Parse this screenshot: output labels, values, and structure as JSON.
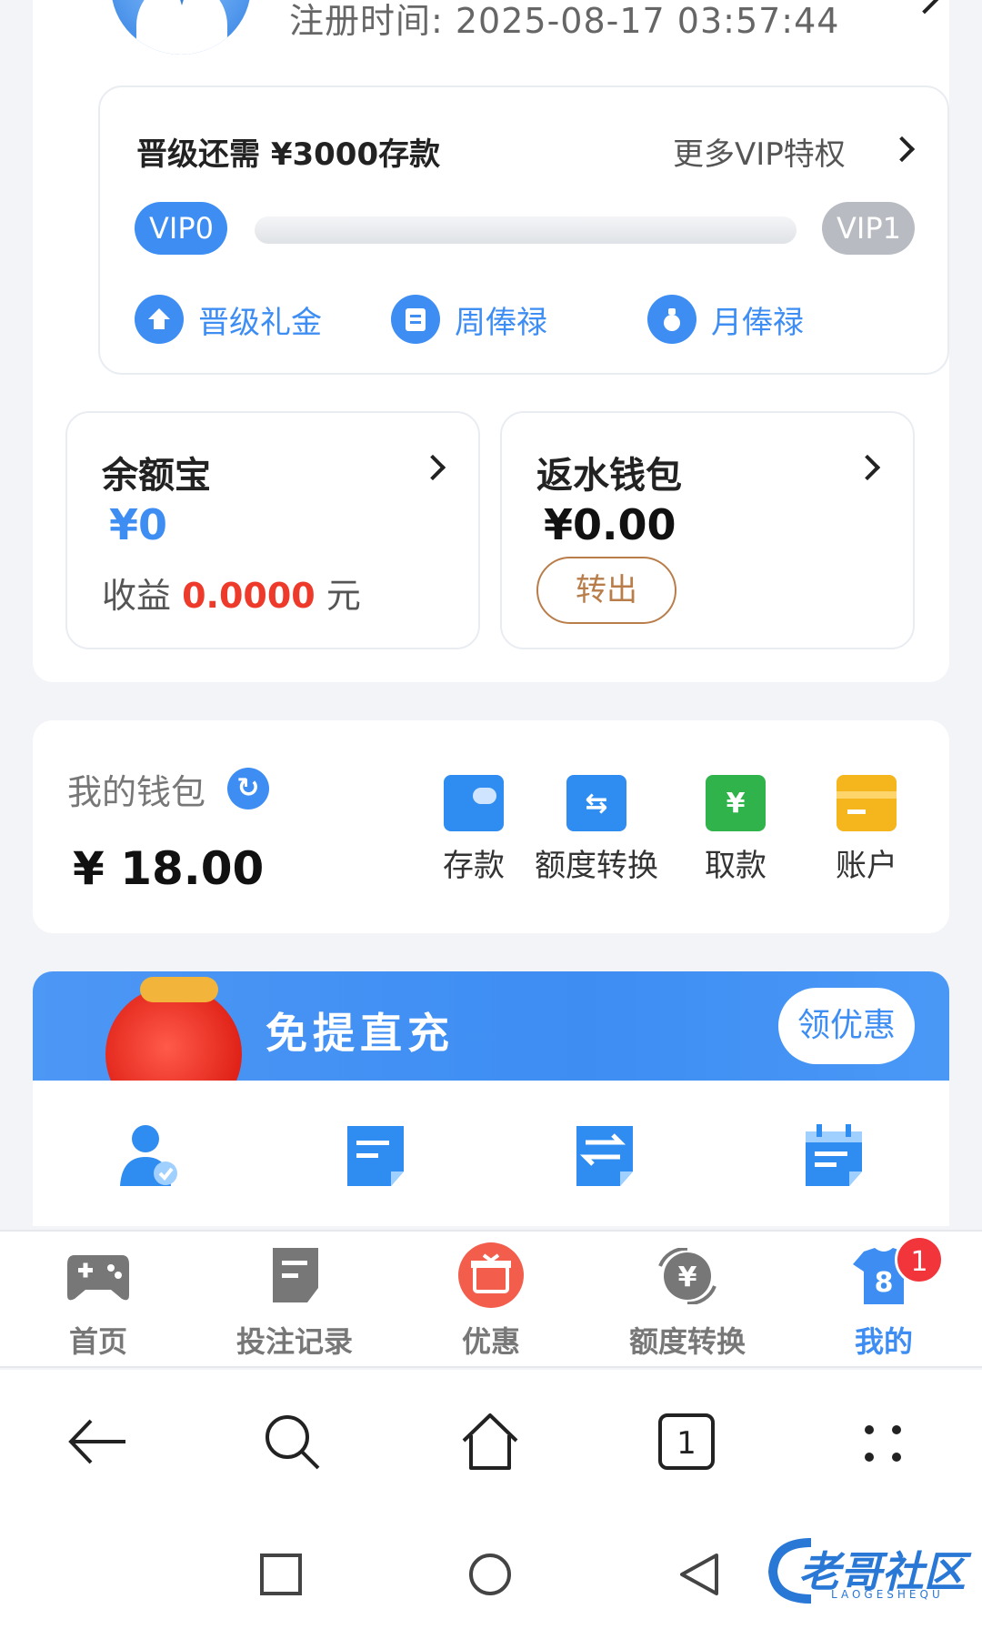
{
  "profile": {
    "reg_time": "注册时间:  2025-08-17 03:57:44"
  },
  "vip": {
    "need_text": "晋级还需  ¥3000存款",
    "more_label": "更多VIP特权",
    "current_level": "VIP0",
    "next_level": "VIP1",
    "progress": 0,
    "perks": [
      {
        "label": "晋级礼金",
        "icon": "upgrade-icon"
      },
      {
        "label": "周俸禄",
        "icon": "clipboard-icon"
      },
      {
        "label": "月俸禄",
        "icon": "moneybag-icon"
      }
    ]
  },
  "yuebao": {
    "title": "余额宝",
    "amount": "¥0",
    "earn_prefix": "收益",
    "earn_value": "0.0000",
    "earn_unit": "元"
  },
  "rebate": {
    "title": "返水钱包",
    "amount": "¥0.00",
    "transfer_label": "转出"
  },
  "wallet": {
    "title": "我的钱包",
    "amount": "¥  18.00",
    "actions": [
      {
        "label": "存款",
        "icon": "wallet-icon",
        "color": "#2f8cf0"
      },
      {
        "label": "额度转换",
        "icon": "transfer-icon",
        "color": "#2f8cf0"
      },
      {
        "label": "取款",
        "icon": "atm-icon",
        "color": "#2fb34a"
      },
      {
        "label": "账户",
        "icon": "card-icon",
        "color": "#f5b51c"
      }
    ]
  },
  "promo": {
    "title": "免提直充",
    "claim_label": "领优惠"
  },
  "tabs": [
    {
      "label": "首页",
      "icon": "gamepad-icon"
    },
    {
      "label": "投注记录",
      "icon": "record-icon"
    },
    {
      "label": "优惠",
      "icon": "gift-icon"
    },
    {
      "label": "额度转换",
      "icon": "exchange-icon"
    },
    {
      "label": "我的",
      "icon": "jersey-icon",
      "badge": "1",
      "jersey_number": "8"
    }
  ],
  "browser": {
    "tab_count": "1"
  },
  "watermark": {
    "text": "老哥社区",
    "sub": "LAOGESHEQU"
  },
  "colors": {
    "accent": "#3d8df3",
    "red": "#ee3a2b",
    "brown": "#b97d4a"
  }
}
